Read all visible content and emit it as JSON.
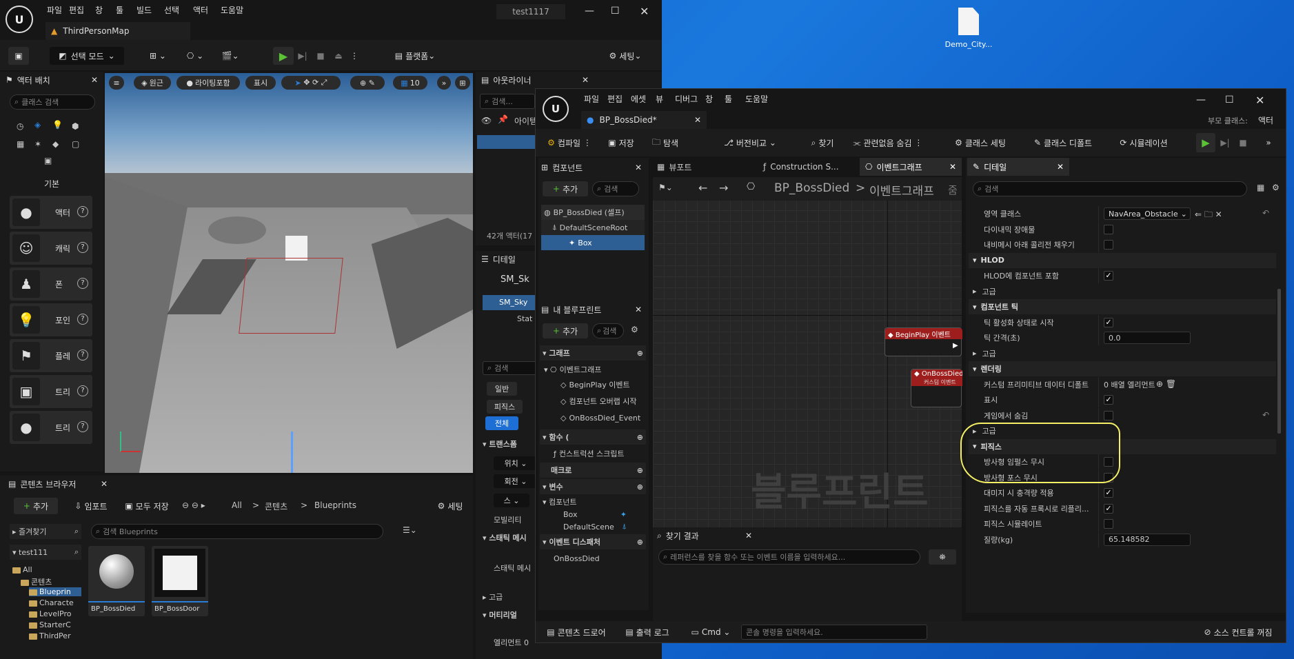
{
  "desktop": {
    "file_label": "Demo_City..."
  },
  "ue_main": {
    "menu": [
      "파일",
      "편집",
      "창",
      "툴",
      "빌드",
      "선택",
      "액터",
      "도움말"
    ],
    "project": "test1117",
    "map_tab": "ThirdPersonMap",
    "toolbar": {
      "select_mode": "선택 모드",
      "platform": "플랫폼",
      "settings": "세팅"
    },
    "place_actors": {
      "title": "액터 배치",
      "search_placeholder": "클래스 검색",
      "category": "기본",
      "items": [
        "액터",
        "캐릭",
        "폰",
        "포인",
        "플레",
        "트리",
        "트리"
      ]
    },
    "viewport": {
      "perspective": "원근",
      "lighting": "라이팅포함",
      "show": "표시",
      "grid": "10"
    },
    "outliner": {
      "title": "아웃라이너",
      "search_placeholder": "검색...",
      "col": "아이템",
      "count": "42개 액터(17"
    },
    "details": {
      "title": "디테일",
      "obj": "SM_Sk",
      "obj2": "SM_Sky",
      "sub": "Stat",
      "search": "검색",
      "filters": [
        "일반",
        "피직스",
        "전체"
      ],
      "transform": "트랜스폼",
      "loc": "위치",
      "rot": "회전",
      "scale": "스",
      "mobility": "모빌리티",
      "static_mesh": "스태틱 메시",
      "sm_field": "스태틱 메시",
      "advanced": "고급",
      "material": "머티리얼",
      "elem": "엘리먼트 0"
    },
    "content_browser": {
      "title": "콘텐츠 브라우저",
      "add": "추가",
      "import": "임포트",
      "save_all": "모두 저장",
      "path": [
        "All",
        "콘텐츠",
        "Blueprints"
      ],
      "settings": "세팅",
      "favorites": "즐겨찾기",
      "project": "test111",
      "search_placeholder": "검색 Blueprints",
      "tree": [
        "All",
        "콘텐츠",
        "Blueprin",
        "Characte",
        "LevelPro",
        "StarterC",
        "ThirdPer"
      ],
      "assets": [
        "BP_BossDied",
        "BP_BossDoor"
      ]
    }
  },
  "bp_editor": {
    "menu": [
      "파일",
      "편집",
      "에셋",
      "뷰",
      "디버그",
      "창",
      "툴",
      "도움말"
    ],
    "tab": "BP_BossDied*",
    "parent_label": "부모 클래스:",
    "parent_value": "액터",
    "toolbar": {
      "compile": "컴파일",
      "save": "저장",
      "browse": "탐색",
      "diff": "버전비교",
      "find": "찾기",
      "hide_unrelated": "관련없음 숨김",
      "class_settings": "클래스 세팅",
      "class_defaults": "클래스 디폴트",
      "simulation": "시뮬레이션"
    },
    "components": {
      "title": "컴포넌트",
      "add": "추가",
      "search_placeholder": "검색",
      "items": [
        "BP_BossDied (셀프)",
        "DefaultSceneRoot",
        "Box"
      ]
    },
    "my_blueprint": {
      "title": "내 블루프린트",
      "add": "추가",
      "search_placeholder": "검색",
      "graph_section": "그래프",
      "event_graph": "이벤트그래프",
      "events": [
        "BeginPlay 이벤트",
        "컴포넌트 오버랩 시작",
        "OnBossDied_Event"
      ],
      "functions_section": "함수 (",
      "construction": "컨스트럭션 스크립트",
      "macros": "매크로",
      "variables": "변수",
      "components_cat": "컴포넌트",
      "vars": [
        "Box",
        "DefaultScene"
      ],
      "dispatchers": "이벤트 디스패처",
      "dispatcher_item": "OnBossDied"
    },
    "graph_tabs": {
      "viewport": "뷰포트",
      "construction": "Construction S...",
      "event_graph": "이벤트그래프"
    },
    "breadcrumb": {
      "root": "BP_BossDied",
      "current": "이벤트그래프",
      "zoom": "줌"
    },
    "nodes": {
      "beginplay": "BeginPlay 이벤트",
      "onbossdied": "OnBossDied_",
      "onbossdied_sub": "커스텀 이벤트"
    },
    "watermark": "블루프린트",
    "find_results": {
      "title": "찾기 결과",
      "placeholder": "레퍼런스를 찾을 함수 또는 이벤트 이름을 입력하세요..."
    },
    "details": {
      "title": "디테일",
      "search_placeholder": "검색",
      "rows": [
        {
          "type": "prop",
          "label": "영역 클래스",
          "value": "NavArea_Obstacle"
        },
        {
          "type": "prop",
          "label": "다이내믹 장애물",
          "check": false
        },
        {
          "type": "prop",
          "label": "내비메시 아래 콜리전 채우기",
          "check": false
        },
        {
          "type": "sec",
          "label": "HLOD"
        },
        {
          "type": "prop",
          "label": "HLOD에 컴포넌트 포함",
          "check": true
        },
        {
          "type": "sub",
          "label": "고급"
        },
        {
          "type": "sec",
          "label": "컴포넌트 틱"
        },
        {
          "type": "prop",
          "label": "틱 활성화 상태로 시작",
          "check": true
        },
        {
          "type": "prop",
          "label": "틱 간격(초)",
          "value": "0.0"
        },
        {
          "type": "sub",
          "label": "고급"
        },
        {
          "type": "sec",
          "label": "렌더링"
        },
        {
          "type": "prop",
          "label": "커스텀 프리미티브 데이터 디폴트",
          "value": "0 배열 엘리먼트"
        },
        {
          "type": "prop",
          "label": "표시",
          "check": true
        },
        {
          "type": "prop",
          "label": "게임에서 숨김",
          "check": false
        },
        {
          "type": "sub",
          "label": "고급"
        },
        {
          "type": "sec",
          "label": "피직스"
        },
        {
          "type": "prop",
          "label": "방사형 임펄스 무시",
          "check": false
        },
        {
          "type": "prop",
          "label": "방사형 포스 무시",
          "check": false
        },
        {
          "type": "prop",
          "label": "대미지 시 충격량 적용",
          "check": true
        },
        {
          "type": "prop",
          "label": "피직스를 자동 프록시로 리플리...",
          "check": true
        },
        {
          "type": "prop",
          "label": "피직스 시뮬레이트",
          "check": false
        },
        {
          "type": "prop",
          "label": "질량(kg)",
          "value": "65.148582"
        }
      ]
    },
    "bottom": {
      "content_drawer": "콘텐츠 드로어",
      "output_log": "출력 로그",
      "cmd": "Cmd",
      "console_placeholder": "콘솔 명령을 입력하세요.",
      "source_control": "소스 컨트롤 꺼짐"
    }
  },
  "colors": {
    "highlight": "#f5f065",
    "accent": "#2a7ed8",
    "play": "#5bc236",
    "node_red": "#9e1d1d"
  }
}
